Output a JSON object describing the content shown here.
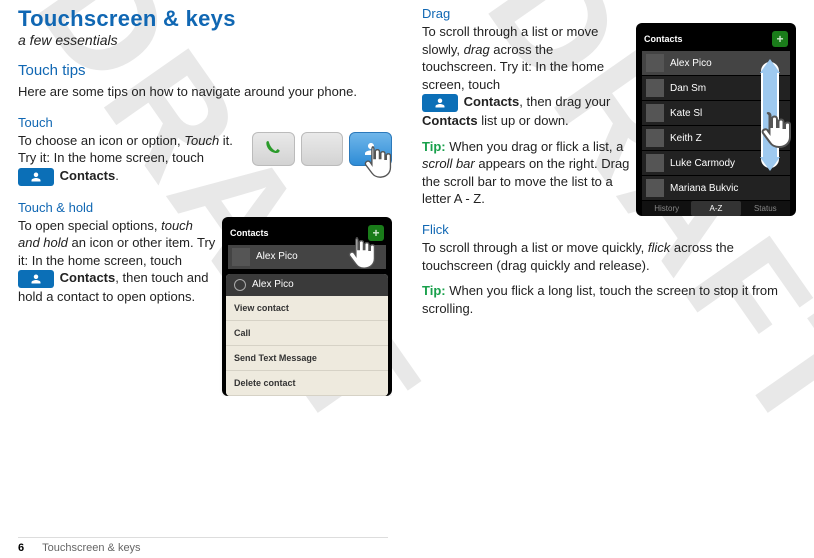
{
  "page": {
    "title": "Touchscreen & keys",
    "subtitle": "a few essentials",
    "footer_page": "6",
    "footer_section": "Touchscreen & keys"
  },
  "left": {
    "tips_heading": "Touch tips",
    "tips_body": "Here are some tips on how to navigate around your phone.",
    "touch_heading": "Touch",
    "touch_body_a": "To choose an icon or option, ",
    "touch_body_b": " it. Try it: In the home screen, touch ",
    "touch_emph": "Touch",
    "touch_contacts": "Contacts",
    "touch_body_c": ".",
    "hold_heading": "Touch & hold",
    "hold_body_a": "To open special options, ",
    "hold_emph": "touch and hold",
    "hold_body_b": " an icon or other item. Try it: In the home screen, touch ",
    "hold_contacts": "Contacts",
    "hold_body_c": ", then touch and hold a contact to open options."
  },
  "right": {
    "drag_heading": "Drag",
    "drag_body_a": "To scroll through a list or move slowly, ",
    "drag_emph": "drag",
    "drag_body_b": " across the touchscreen. Try it: In the home screen, touch ",
    "drag_contacts": "Contacts",
    "drag_body_c": ", then drag your ",
    "drag_contacts_b": "Contacts",
    "drag_body_d": " list up or down.",
    "drag_tip_label": "Tip:",
    "drag_tip_a": " When you drag or flick a list, a ",
    "drag_tip_emph": "scroll bar",
    "drag_tip_b": " appears on the right. Drag the scroll bar to move the list to a letter A - Z.",
    "flick_heading": "Flick",
    "flick_body_a": "To scroll through a list or move quickly, ",
    "flick_emph": "flick",
    "flick_body_b": " across the touchscreen (drag quickly and release).",
    "flick_tip_label": "Tip:",
    "flick_tip": " When you flick a long list, touch the screen to stop it from scrolling."
  },
  "contacts_fig": {
    "header": "Contacts",
    "row_name": "Alex Pico",
    "popup_name": "Alex Pico",
    "menu": [
      "View contact",
      "Call",
      "Send Text Message",
      "Delete contact"
    ]
  },
  "drag_fig": {
    "header": "Contacts",
    "names": [
      "Alex Pico",
      "Dan Sm",
      "Kate Sl",
      "Keith Z",
      "Luke Carmody",
      "Mariana Bukvic"
    ],
    "tabs": [
      "History",
      "A-Z",
      "Status"
    ]
  }
}
